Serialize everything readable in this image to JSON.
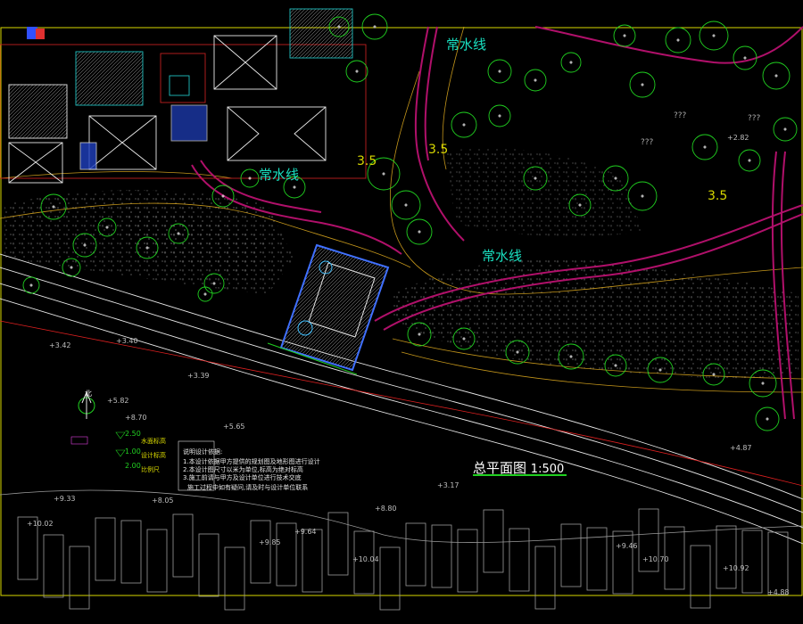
{
  "drawing": {
    "title": "总平面图",
    "scale": "1:500",
    "water_line_labels": [
      "常水线",
      "常水线",
      "常水线"
    ],
    "elevation_labels": [
      "3.5",
      "3.5",
      "3.5"
    ],
    "legend_items": [
      "2.50",
      "1.00",
      "2.00"
    ],
    "legend_notes": [
      "水面标高",
      "设计标高",
      "比例尺"
    ],
    "north_label": "北",
    "notes_heading": "说明设计依据:",
    "notes_lines": [
      "1.本设计依据甲方提供的规划图及地形图进行设计",
      "2.本设计图尺寸以米为单位,标高为绝对标高",
      "3.施工前请与甲方及设计单位进行技术交底"
    ],
    "notes_footer": "施工过程中如有疑问,请及时与设计单位联系",
    "spot_elevations": [
      "3.42",
      "3.40",
      "3.39",
      "5.82",
      "5.65",
      "8.70",
      "9.33",
      "8.05",
      "10.02",
      "9.85",
      "10.04",
      "9.64",
      "8.80",
      "4.87",
      "9.46",
      "10.70",
      "10.92",
      "4.88",
      "2.82",
      "3.17"
    ],
    "unknown_marks": [
      "???",
      "???",
      "???"
    ]
  },
  "colors": {
    "background": "#000000",
    "water": "#19e0c0",
    "elevation": "#d8d800",
    "paths": "#b0106a",
    "trees": "#20d020",
    "contours": "#e6b020"
  }
}
